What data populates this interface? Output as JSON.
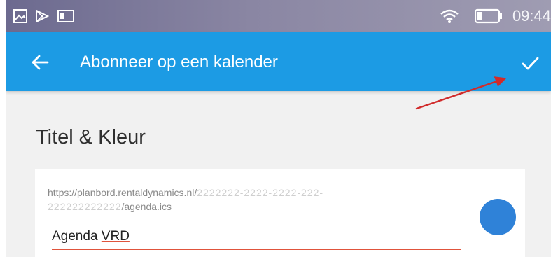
{
  "status_bar": {
    "time": "09:44",
    "icons": [
      "image-icon",
      "play-store-icon",
      "notification-icon",
      "wifi-icon",
      "battery-icon"
    ]
  },
  "app_bar": {
    "back_icon": "arrow-left-icon",
    "title": "Abonneer op een kalender",
    "confirm_icon": "checkmark-icon",
    "background_color": "#1c9be4"
  },
  "section": {
    "title": "Titel & Kleur"
  },
  "calendar": {
    "url_line1_prefix": "https://planbord.rentaldynamics.nl/",
    "url_line1_redacted": "2222222-2222-2222-222-",
    "url_line2_redacted": "222222222222",
    "url_line2_suffix": "/agenda.ics",
    "name_part1": "Agenda",
    "name_part2": "VRD",
    "color": "#2f82d8"
  },
  "annotation": {
    "arrow_color": "#d12b2b"
  }
}
